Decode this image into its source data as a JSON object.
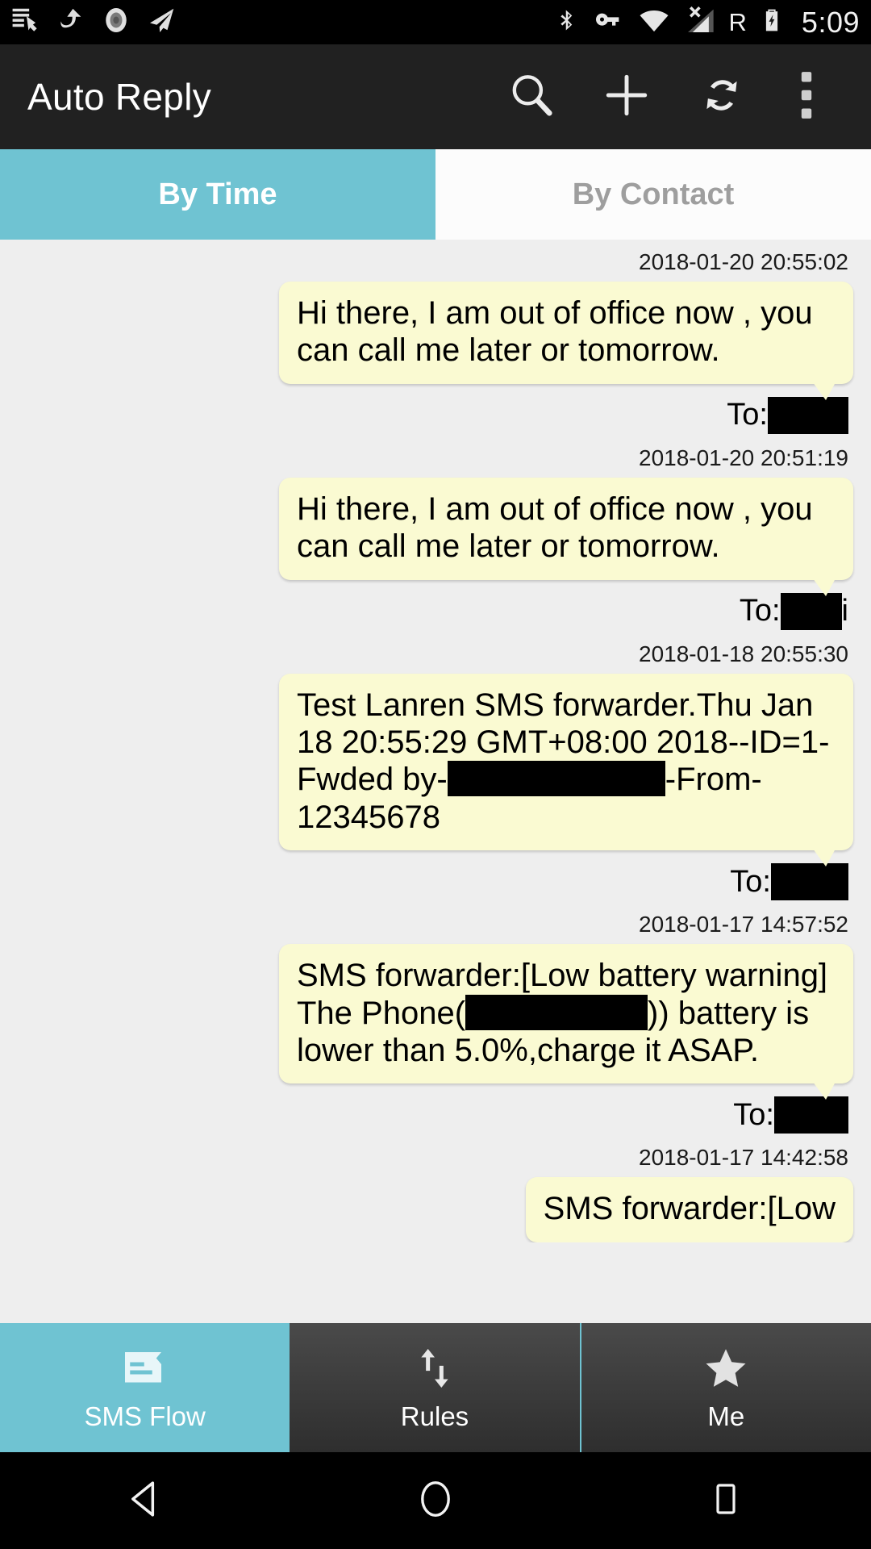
{
  "status_bar": {
    "time": "5:09",
    "roaming_label": "R",
    "left_icons": [
      "sim-card-hand-icon",
      "share-arrow-icon",
      "record-circle-icon",
      "send-plane-icon"
    ],
    "right_icons": [
      "bluetooth-icon",
      "vpn-key-icon",
      "wifi-icon",
      "cellular-signal-off-icon",
      "battery-charging-icon"
    ]
  },
  "app_bar": {
    "title": "Auto Reply",
    "actions": [
      {
        "name": "search-icon"
      },
      {
        "name": "add-icon"
      },
      {
        "name": "refresh-icon"
      },
      {
        "name": "overflow-menu-icon"
      }
    ],
    "background": "#212121"
  },
  "tabs": {
    "accent_color": "#6FC3D2",
    "items": [
      {
        "label": "By Time",
        "active": true
      },
      {
        "label": "By Contact",
        "active": false
      }
    ]
  },
  "messages": [
    {
      "timestamp": "2018-01-20 20:55:02",
      "text": "Hi there, I am out of office now , you can call me later or tomorrow.",
      "to_label": "To:",
      "to_value": "",
      "redacted": true
    },
    {
      "timestamp": "2018-01-20 20:51:19",
      "text": "Hi there, I am out of office now , you can call me later or tomorrow.",
      "to_label": "To:",
      "to_value": "i",
      "redacted": true
    },
    {
      "timestamp": "2018-01-18 20:55:30",
      "text_part1": "Test Lanren SMS forwarder.Thu Jan 18 20:55:29 GMT+08:00 2018--ID=1-Fwded by-",
      "text_part2": "-From-12345678",
      "to_label": "To:",
      "to_value": "",
      "redacted": true
    },
    {
      "timestamp": "2018-01-17 14:57:52",
      "text_part1": "SMS forwarder:[Low battery warning] The Phone(",
      "text_part2": ")) battery is lower than 5.0%,charge it ASAP.",
      "to_label": "To:",
      "to_value": "",
      "redacted": true
    },
    {
      "timestamp": "2018-01-17 14:42:58",
      "text": "SMS forwarder:[Low",
      "clipped": true
    }
  ],
  "bubble": {
    "background": "#FAFAD2",
    "text_color": "#000000"
  },
  "bottom_nav": {
    "items": [
      {
        "label": "SMS Flow",
        "icon": "message-flow-icon",
        "active": true
      },
      {
        "label": "Rules",
        "icon": "sort-arrows-icon",
        "active": false
      },
      {
        "label": "Me",
        "icon": "star-icon",
        "active": false
      }
    ]
  },
  "android_nav": {
    "buttons": [
      {
        "name": "back-button",
        "icon": "back-triangle-icon"
      },
      {
        "name": "home-button",
        "icon": "home-circle-icon"
      },
      {
        "name": "recents-button",
        "icon": "recents-square-icon"
      }
    ]
  }
}
